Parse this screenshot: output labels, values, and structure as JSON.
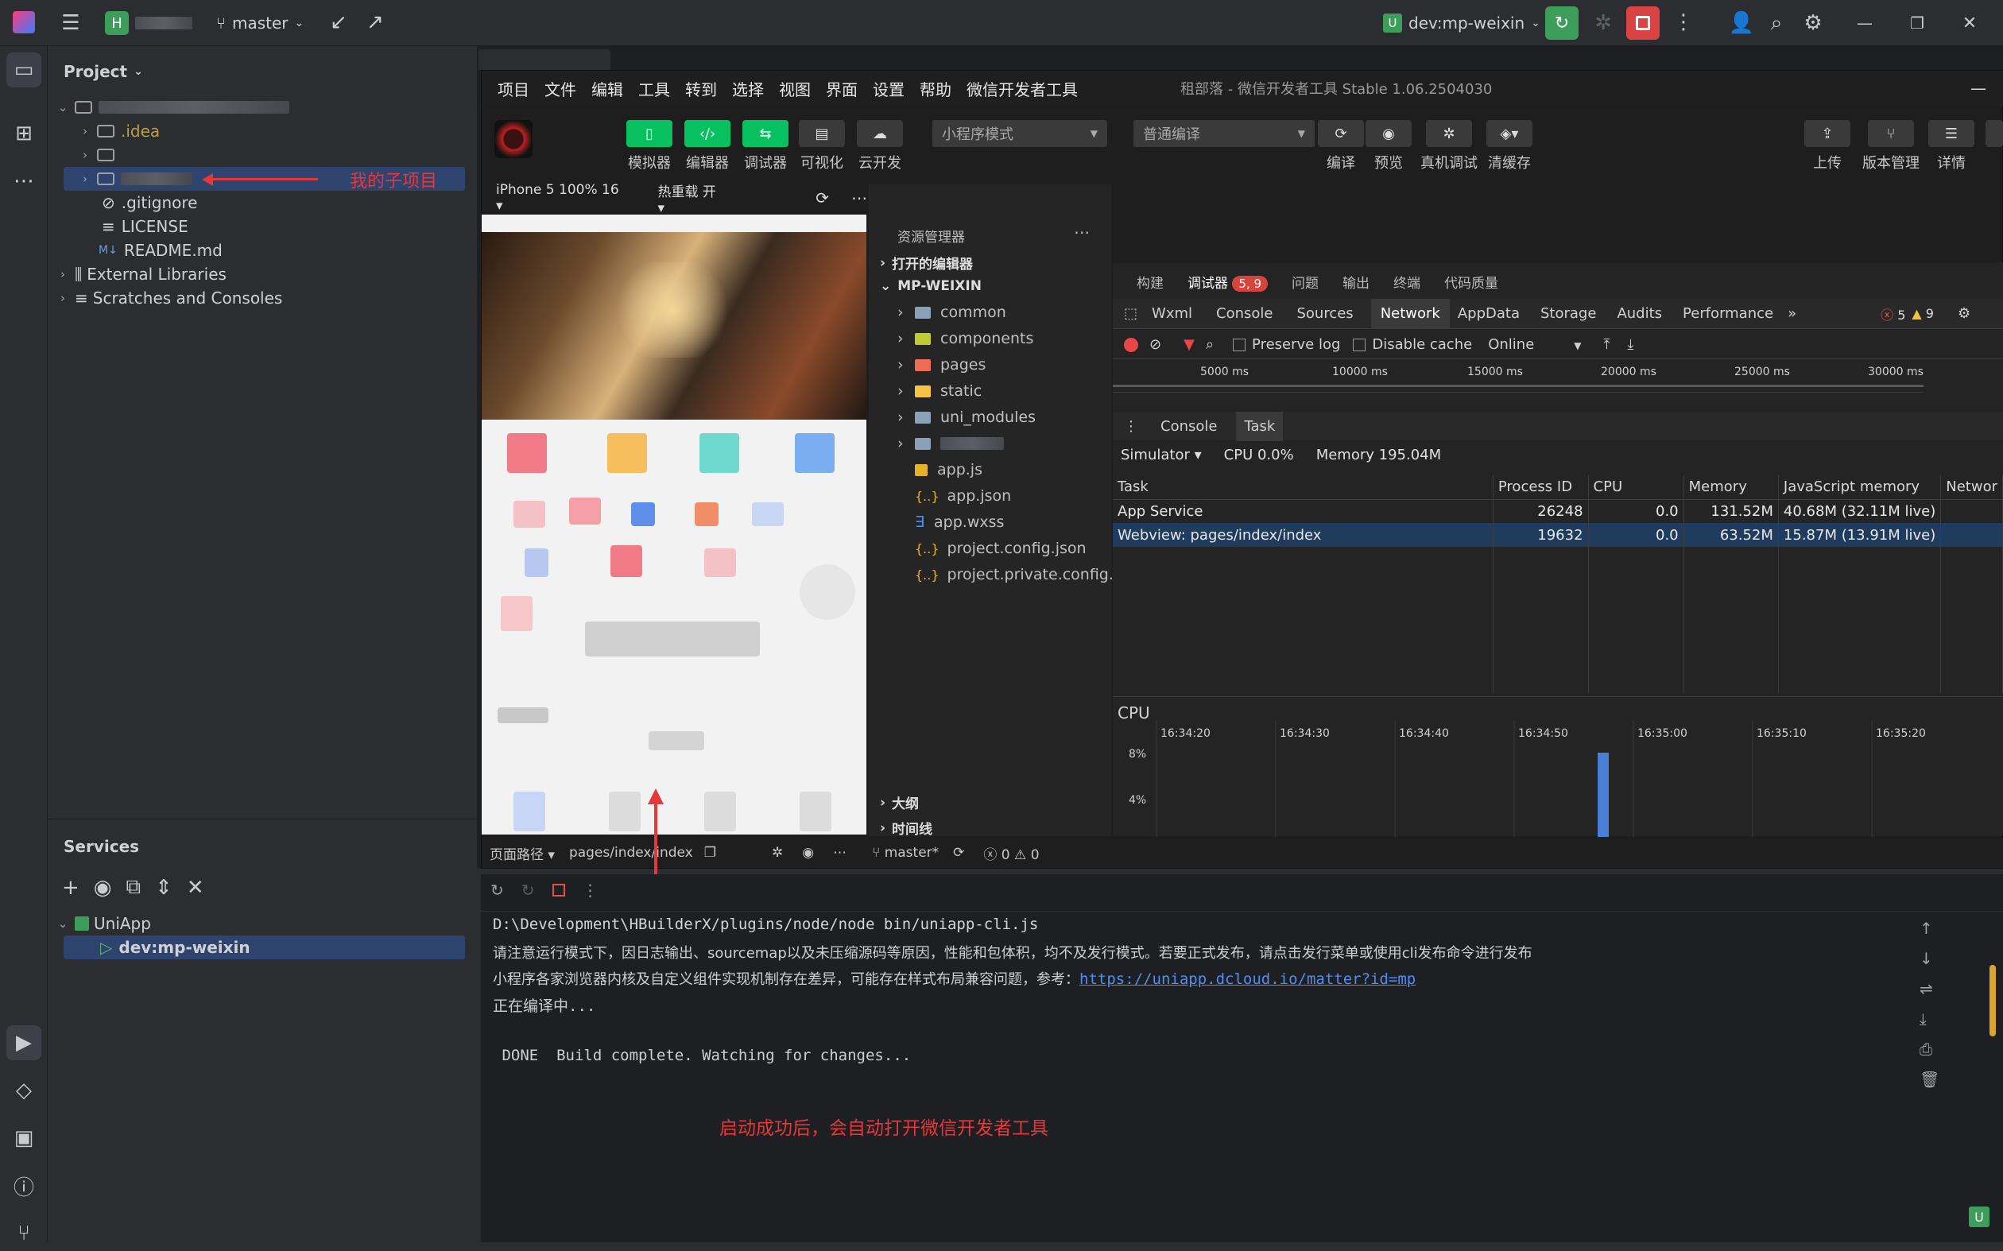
{
  "topbar": {
    "project_badge": "H",
    "branch": "master",
    "run_config": "dev:mp-weixin",
    "run_badge": "U"
  },
  "project_panel": {
    "title": "Project",
    "items": [
      {
        "label": ".idea"
      },
      {
        "label": ""
      },
      {
        "label": ""
      },
      {
        "label": ".gitignore"
      },
      {
        "label": "LICENSE"
      },
      {
        "label": "README.md"
      },
      {
        "label": "External Libraries"
      },
      {
        "label": "Scratches and Consoles"
      }
    ],
    "annotation": "我的子项目"
  },
  "services": {
    "title": "Services",
    "group": "UniApp",
    "run_item": "dev:mp-weixin"
  },
  "devtools": {
    "menu": [
      "项目",
      "文件",
      "编辑",
      "工具",
      "转到",
      "选择",
      "视图",
      "界面",
      "设置",
      "帮助",
      "微信开发者工具"
    ],
    "window_title": "租部落 - 微信开发者工具 Stable 1.06.2504030",
    "toolbar_left": [
      "模拟器",
      "编辑器",
      "调试器",
      "可视化",
      "云开发"
    ],
    "mode_select": "小程序模式",
    "compile_select": "普通编译",
    "toolbar_mid": [
      "编译",
      "预览",
      "真机调试",
      "清缓存"
    ],
    "toolbar_right": [
      "上传",
      "版本管理",
      "详情"
    ],
    "device": "iPhone 5 100% 16",
    "hot_reload": "热重载 开",
    "page_path_label": "页面路径",
    "page_path": "pages/index/index",
    "branch": "master*",
    "problems": "0",
    "warnings": "0"
  },
  "explorer": {
    "title": "资源管理器",
    "open_editors": "打开的编辑器",
    "root": "MP-WEIXIN",
    "items": [
      {
        "label": "common",
        "icon": "folder"
      },
      {
        "label": "components",
        "icon": "folder-components"
      },
      {
        "label": "pages",
        "icon": "folder-pages"
      },
      {
        "label": "static",
        "icon": "folder-static"
      },
      {
        "label": "uni_modules",
        "icon": "folder"
      },
      {
        "label": "",
        "icon": "folder"
      },
      {
        "label": "app.js",
        "icon": "js"
      },
      {
        "label": "app.json",
        "icon": "json"
      },
      {
        "label": "app.wxss",
        "icon": "css"
      },
      {
        "label": "project.config.json",
        "icon": "json"
      },
      {
        "label": "project.private.config.js...",
        "icon": "json"
      }
    ],
    "outline": "大纲",
    "timeline": "时间线"
  },
  "debugger": {
    "top_tabs": [
      "构建",
      "调试器",
      "问题",
      "输出",
      "终端",
      "代码质量"
    ],
    "debug_badge": "5, 9",
    "tabs": [
      "Wxml",
      "Console",
      "Sources",
      "Network",
      "AppData",
      "Storage",
      "Audits",
      "Performance"
    ],
    "errors": "5",
    "warnings": "9",
    "preserve_log": "Preserve log",
    "disable_cache": "Disable cache",
    "throttle": "Online",
    "timeline_ticks": [
      "5000 ms",
      "10000 ms",
      "15000 ms",
      "20000 ms",
      "25000 ms",
      "30000 ms"
    ],
    "drawer_tabs": [
      "Console",
      "Task"
    ],
    "simulator": "Simulator",
    "cpu": "CPU 0.0%",
    "memory": "Memory 195.04M",
    "columns": [
      "Task",
      "Process ID",
      "CPU",
      "Memory",
      "JavaScript memory",
      "Networ"
    ],
    "rows": [
      {
        "task": "App Service",
        "pid": "26248",
        "cpu": "0.0",
        "mem": "131.52M",
        "js": "40.68M (32.11M live)"
      },
      {
        "task": "Webview: pages/index/index",
        "pid": "19632",
        "cpu": "0.0",
        "mem": "63.52M",
        "js": "15.87M (13.91M live)"
      }
    ],
    "cpu_title": "CPU",
    "cpu_times": [
      "16:34:20",
      "16:34:30",
      "16:34:40",
      "16:34:50",
      "16:35:00",
      "16:35:10",
      "16:35:20"
    ],
    "cpu_levels": [
      "8%",
      "4%"
    ]
  },
  "console": {
    "lines": [
      "D:\\Development\\HBuilderX/plugins/node/node bin/uniapp-cli.js",
      "请注意运行模式下，因日志输出、sourcemap以及未压缩源码等原因，性能和包体积，均不及发行模式。若要正式发布，请点击发行菜单或使用cli发布命令进行发布",
      "小程序各家浏览器内核及自定义组件实现机制存在差异，可能存在样式布局兼容问题，参考：",
      "https://uniapp.dcloud.io/matter?id=mp",
      "正在编译中...",
      " DONE  Build complete. Watching for changes..."
    ],
    "annotation": "启动成功后，会自动打开微信开发者工具"
  },
  "colors": {
    "accent": "#07c160",
    "annotation": "#e5383b",
    "selection": "#1f3b5e"
  }
}
